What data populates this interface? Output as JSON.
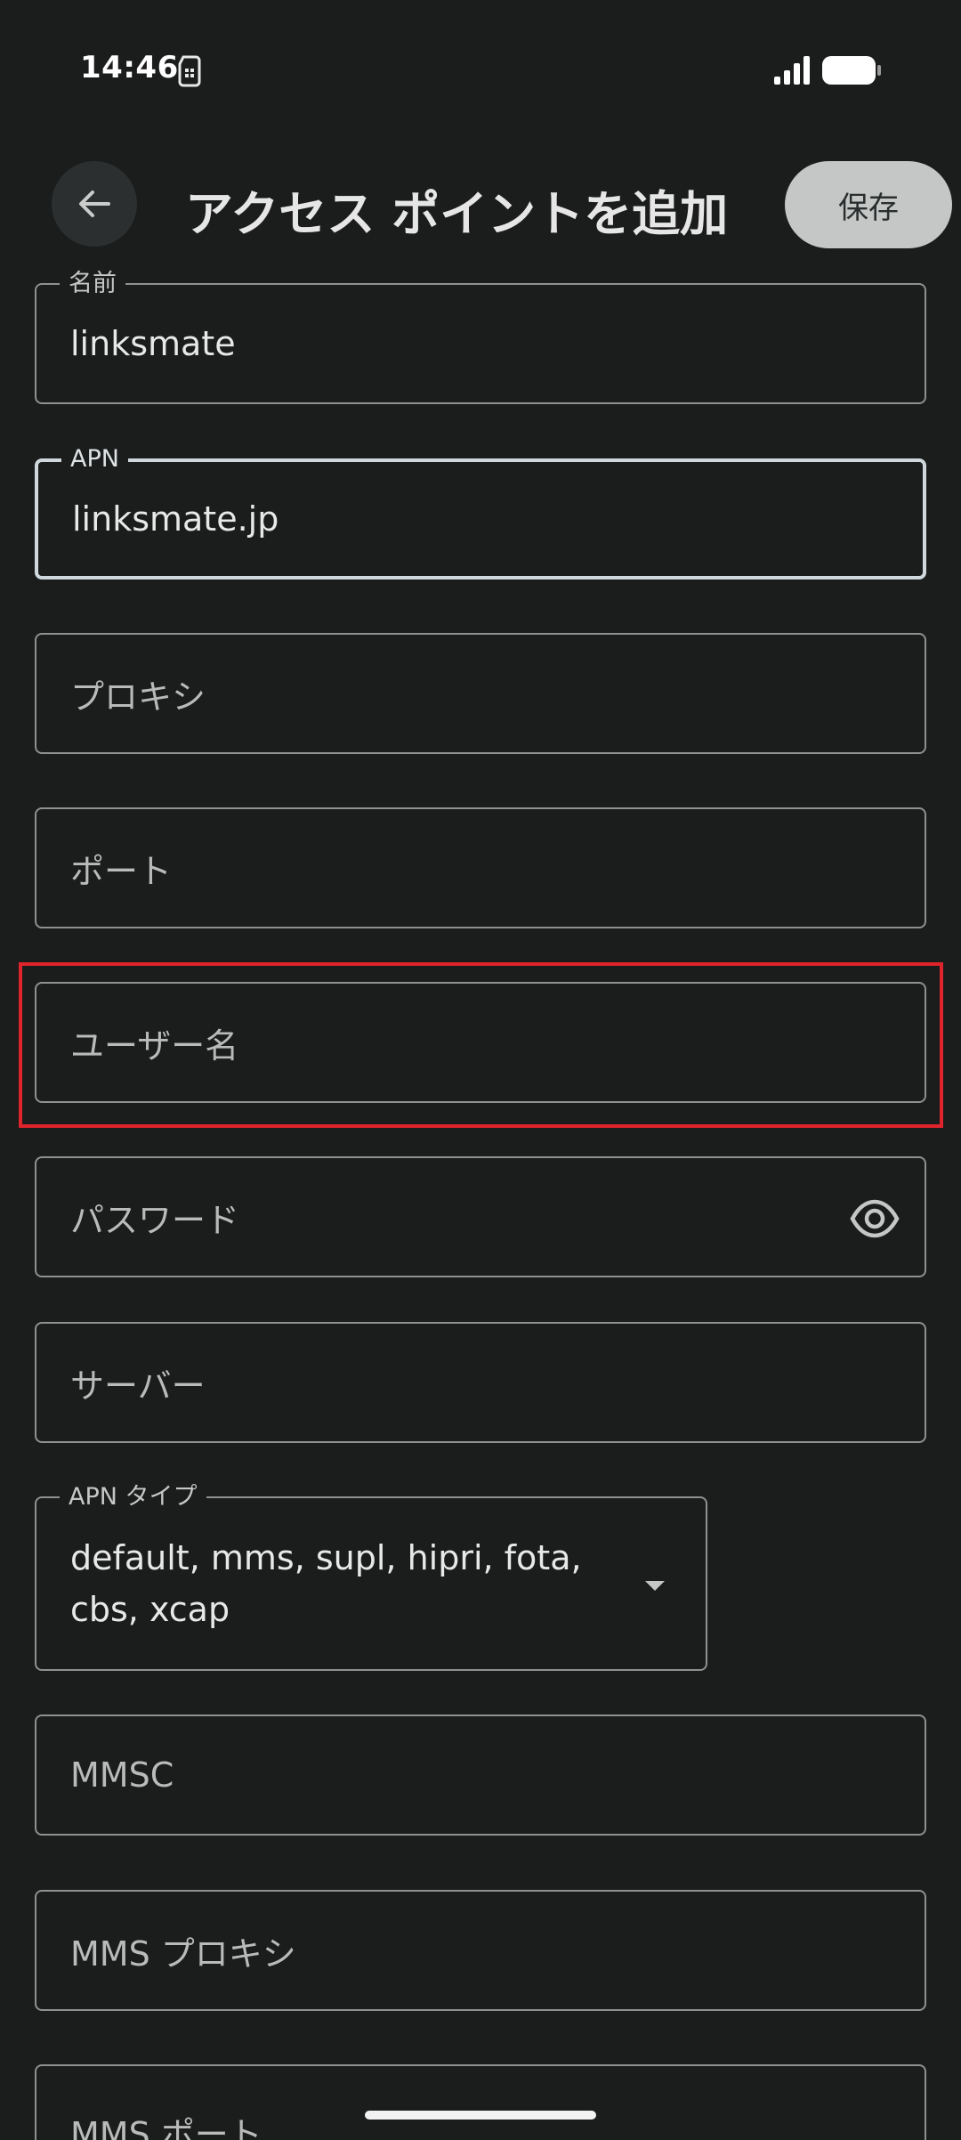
{
  "status_bar": {
    "time": "14:46",
    "icons": [
      "sim-card-icon",
      "signal-icon",
      "battery-icon"
    ]
  },
  "app_bar": {
    "back_icon": "arrow-back-icon",
    "title": "アクセス ポイントを追加",
    "save_label": "保存"
  },
  "fields": {
    "name": {
      "label": "名前",
      "value": "linksmate"
    },
    "apn": {
      "label": "APN",
      "value": "linksmate.jp"
    },
    "proxy": {
      "placeholder": "プロキシ"
    },
    "port": {
      "placeholder": "ポート"
    },
    "username": {
      "placeholder": "ユーザー名"
    },
    "password": {
      "placeholder": "パスワード",
      "icon": "eye-icon"
    },
    "server": {
      "placeholder": "サーバー"
    },
    "apn_type": {
      "label": "APN タイプ",
      "value": "default, mms, supl, hipri, fota, cbs, xcap",
      "icon": "dropdown-arrow-icon"
    },
    "mmsc": {
      "placeholder": "MMSC"
    },
    "mms_proxy": {
      "placeholder": "MMS プロキシ"
    },
    "mms_port": {
      "placeholder": "MMS ポート"
    }
  },
  "colors": {
    "background": "#1b1c1c",
    "outline": "#8e918f",
    "focused_outline": "#cfd8dc",
    "save_button": "#c4c7c5",
    "highlight": "#e0242b"
  }
}
